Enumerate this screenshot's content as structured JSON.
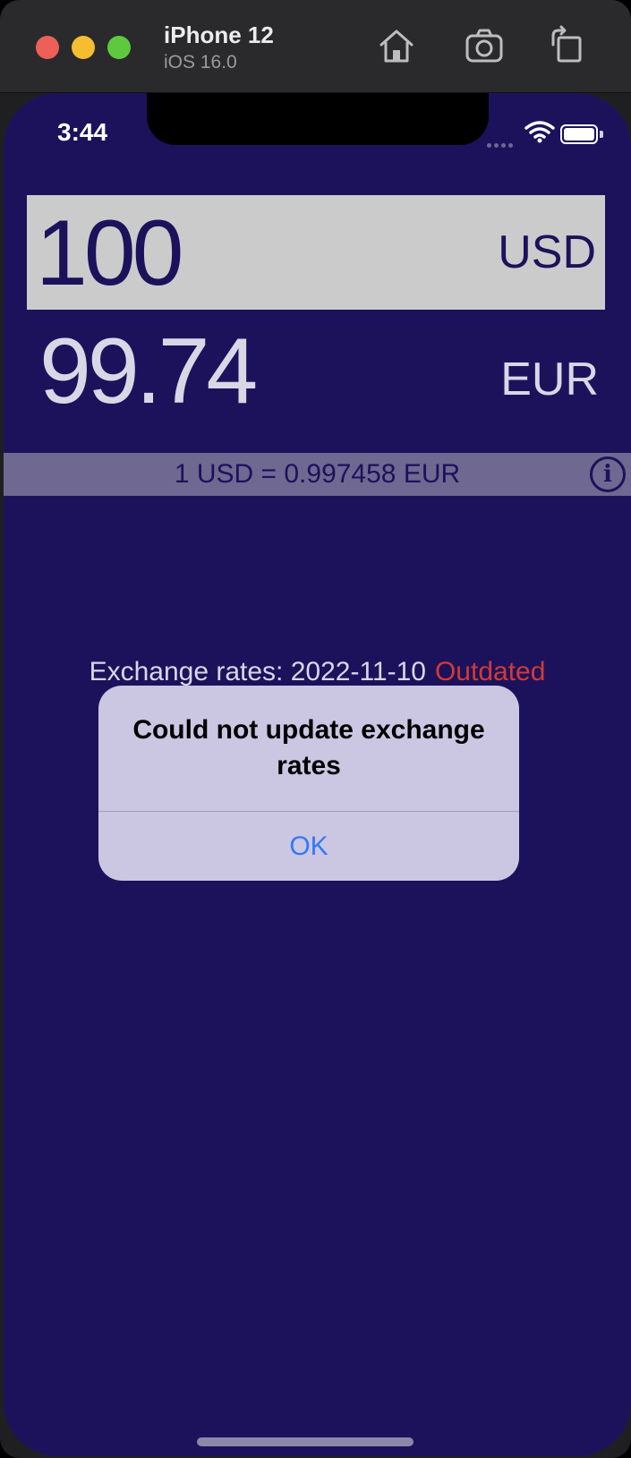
{
  "simulator": {
    "device_name": "iPhone 12",
    "os_version": "iOS 16.0",
    "toolbar_icons": [
      "home-icon",
      "screenshot-icon",
      "rotate-icon"
    ]
  },
  "status_bar": {
    "time": "3:44"
  },
  "converter": {
    "input_amount": "100",
    "input_currency": "USD",
    "output_amount": "99.74",
    "output_currency": "EUR",
    "rate_text": "1 USD = 0.997458 EUR"
  },
  "rates_info": {
    "label": "Exchange rates: 2022-11-10",
    "status": "Outdated"
  },
  "alert": {
    "title": "Could not update exchange rates",
    "ok_label": "OK"
  },
  "colors": {
    "background": "#1c125c",
    "input_box": "#cbcbcb",
    "rate_bar": "#6f6891",
    "outdated": "#d23a36",
    "alert_bg": "#cbc6e2",
    "link_blue": "#3478f6"
  }
}
